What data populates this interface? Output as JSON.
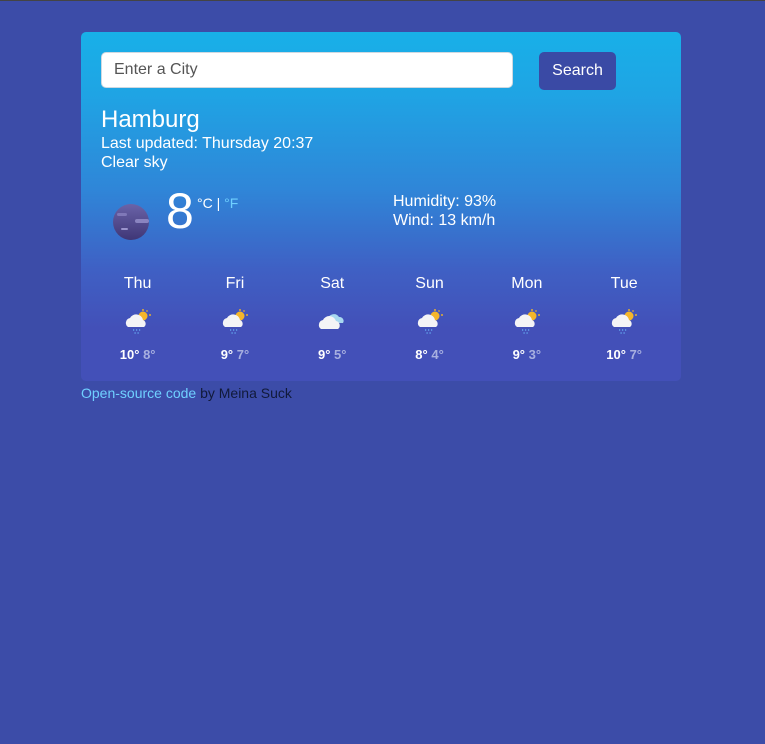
{
  "search": {
    "placeholder": "Enter a City",
    "value": "",
    "button_label": "Search"
  },
  "current": {
    "city": "Hamburg",
    "last_updated": "Last updated: Thursday 20:37",
    "description": "Clear sky",
    "icon": "clear-night-moon-icon",
    "temperature": "8",
    "unit_celsius": "°C",
    "unit_separator": " | ",
    "unit_fahrenheit": "°F",
    "humidity": "Humidity: 93%",
    "wind": "Wind: 13 km/h"
  },
  "forecast": [
    {
      "day": "Thu",
      "icon": "partly-cloudy-rain-icon",
      "max": "10°",
      "min": "8°"
    },
    {
      "day": "Fri",
      "icon": "partly-cloudy-rain-icon",
      "max": "9°",
      "min": "7°"
    },
    {
      "day": "Sat",
      "icon": "cloudy-icon",
      "max": "9°",
      "min": "5°"
    },
    {
      "day": "Sun",
      "icon": "partly-cloudy-rain-icon",
      "max": "8°",
      "min": "4°"
    },
    {
      "day": "Mon",
      "icon": "partly-cloudy-rain-icon",
      "max": "9°",
      "min": "3°"
    },
    {
      "day": "Tue",
      "icon": "partly-cloudy-rain-icon",
      "max": "10°",
      "min": "7°"
    }
  ],
  "footer": {
    "link_text": "Open-source code",
    "suffix": " by Meina Suck"
  },
  "colors": {
    "background": "#3c4ca8",
    "card_top": "#18b0e8",
    "card_bottom": "#4350b8",
    "button": "#3a4aa5",
    "link": "#6fd0ff"
  }
}
